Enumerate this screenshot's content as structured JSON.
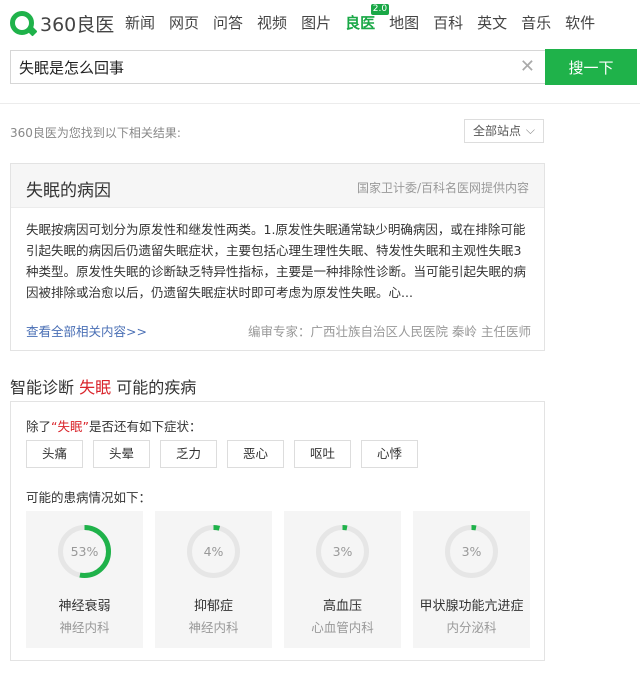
{
  "logo": {
    "text": "360良医"
  },
  "nav": [
    {
      "label": "新闻"
    },
    {
      "label": "网页"
    },
    {
      "label": "问答"
    },
    {
      "label": "视频"
    },
    {
      "label": "图片"
    },
    {
      "label": "良医",
      "active": true,
      "badge": "2.0"
    },
    {
      "label": "地图"
    },
    {
      "label": "百科"
    },
    {
      "label": "英文"
    },
    {
      "label": "音乐"
    },
    {
      "label": "软件"
    }
  ],
  "search": {
    "query": "失眠是怎么回事",
    "button": "搜一下"
  },
  "results": {
    "info": "360良医为您找到以下相关结果:",
    "site_filter": "全部站点"
  },
  "card1": {
    "title": "失眠的病因",
    "source": "国家卫计委/百科名医网提供内容",
    "body": "失眠按病因可划分为原发性和继发性两类。1.原发性失眠通常缺少明确病因，或在排除可能引起失眠的病因后仍遗留失眠症状，主要包括心理生理性失眠、特发性失眠和主观性失眠3种类型。原发性失眠的诊断缺乏特异性指标，主要是一种排除性诊断。当可能引起失眠的病因被排除或治愈以后，仍遗留失眠症状时即可考虑为原发性失眠。心...",
    "more_link": "查看全部相关内容>>",
    "reviewer": "编审专家：广西壮族自治区人民医院 秦岭 主任医师"
  },
  "diagnosis": {
    "title_prefix": "智能诊断",
    "keyword": "失眠",
    "title_suffix": "可能的疾病",
    "question_prefix": "除了",
    "question_keyword": "“失眠”",
    "question_suffix": "是否还有如下症状：",
    "symptoms": [
      "头痛",
      "头晕",
      "乏力",
      "恶心",
      "呕吐",
      "心悸"
    ],
    "maybe_label": "可能的患病情况如下：",
    "diseases": [
      {
        "name": "神经衰弱",
        "dept": "神经内科",
        "pct": "53%",
        "value": 0.53
      },
      {
        "name": "抑郁症",
        "dept": "神经内科",
        "pct": "4%",
        "value": 0.04
      },
      {
        "name": "高血压",
        "dept": "心血管内科",
        "pct": "3%",
        "value": 0.03
      },
      {
        "name": "甲状腺功能亢进症",
        "dept": "内分泌科",
        "pct": "3%",
        "value": 0.03
      }
    ]
  },
  "colors": {
    "accent": "#1fb24a",
    "keyword": "#d9242b",
    "link": "#4a6fb5"
  }
}
